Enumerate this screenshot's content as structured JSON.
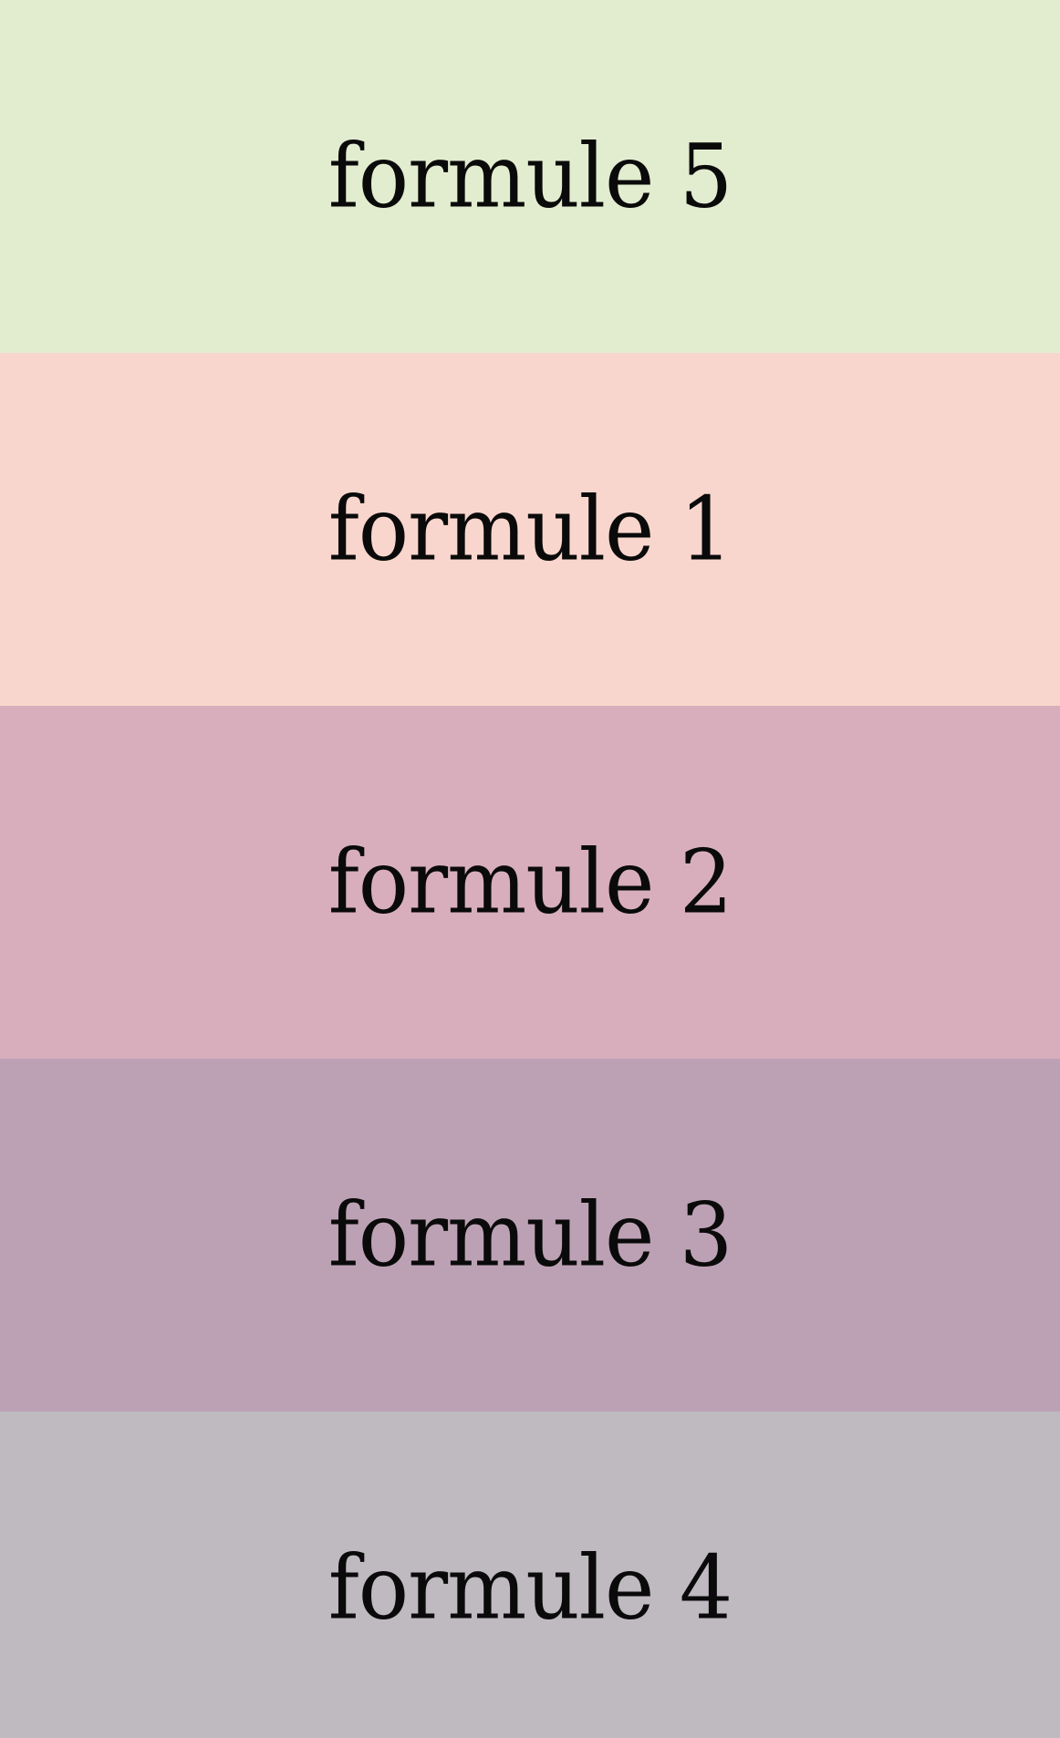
{
  "formules": [
    {
      "label": "formule 5",
      "color": "#e2edd0"
    },
    {
      "label": "formule 1",
      "color": "#f9d6cd"
    },
    {
      "label": "formule 2",
      "color": "#d8aebc"
    },
    {
      "label": "formule 3",
      "color": "#bca1b4"
    },
    {
      "label": "formule 4",
      "color": "#bfb9c0"
    }
  ]
}
